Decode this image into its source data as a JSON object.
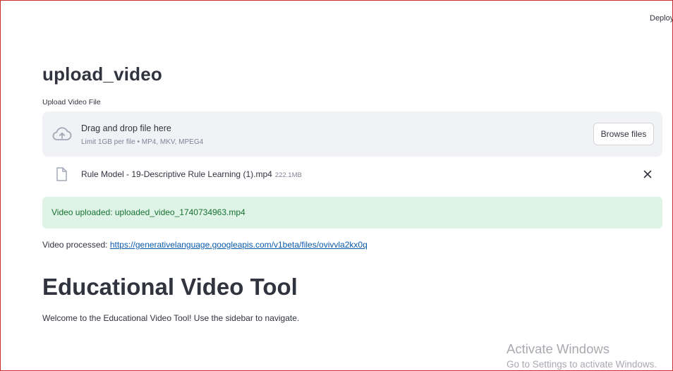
{
  "header": {
    "deploy_label": "Deploy"
  },
  "uploader": {
    "title": "upload_video",
    "label": "Upload Video File",
    "drop_title": "Drag and drop file here",
    "drop_limit": "Limit 1GB per file • MP4, MKV, MPEG4",
    "browse_label": "Browse files",
    "file": {
      "name": "Rule Model - 19-Descriptive Rule Learning (1).mp4",
      "size": "222.1MB"
    }
  },
  "alert": {
    "text": "Video uploaded: uploaded_video_1740734963.mp4"
  },
  "processed": {
    "prefix": "Video processed: ",
    "link": "https://generativelanguage.googleapis.com/v1beta/files/ovivvla2kx0q"
  },
  "page": {
    "heading": "Educational Video Tool",
    "welcome": "Welcome to the Educational Video Tool! Use the sidebar to navigate."
  },
  "watermark": {
    "title": "Activate Windows",
    "subtitle": "Go to Settings to activate Windows."
  },
  "colors": {
    "text": "#31333f",
    "muted": "#808495",
    "dropzone_bg": "#f0f2f6",
    "success_bg": "#dff3e6",
    "success_text": "#177233",
    "link": "#0b5cad",
    "frame": "#c8302c"
  },
  "icons": {
    "upload": "cloud-upload-icon",
    "file": "file-icon",
    "remove": "close-icon"
  }
}
